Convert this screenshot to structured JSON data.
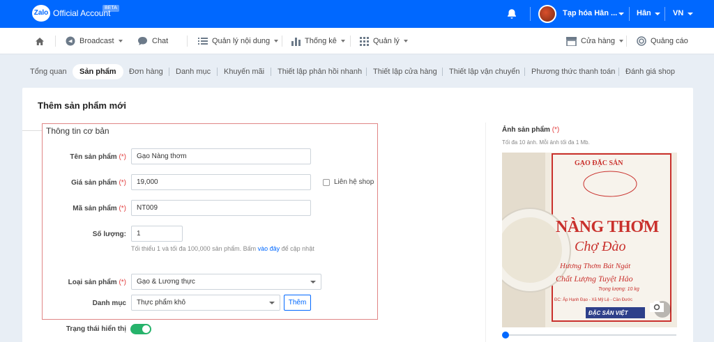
{
  "header": {
    "logo_badge": "Zalo",
    "logo_text": "Official Account",
    "beta": "BETA",
    "shop_name": "Tạp hóa Hân ...",
    "user": "Hân",
    "lang": "VN"
  },
  "nav": {
    "broadcast": "Broadcast",
    "chat": "Chat",
    "content": "Quản lý nội dung",
    "stats": "Thống kê",
    "manage": "Quản lý",
    "store": "Cửa hàng",
    "ads": "Quảng cáo"
  },
  "tabs": [
    "Tổng quan",
    "Sản phẩm",
    "Đơn hàng",
    "Danh mục",
    "Khuyến mãi",
    "Thiết lập phản hồi nhanh",
    "Thiết lập cửa hàng",
    "Thiết lập vận chuyển",
    "Phương thức thanh toán",
    "Đánh giá shop"
  ],
  "form": {
    "title": "Thêm sản phẩm mới",
    "section_title": "Thông tin cơ bản",
    "req_mark": "(*)",
    "name_label": "Tên sản phẩm",
    "name_value": "Gạo Nàng thơm",
    "price_label": "Giá sản phẩm",
    "price_value": "19,000",
    "contact_label": "Liên hệ shop",
    "sku_label": "Mã sản phẩm",
    "sku_value": "NT009",
    "qty_label": "Số lượng:",
    "qty_value": "1",
    "qty_hint_a": "Tối thiểu 1 và tối đa 100,000 sản phẩm. Bấm ",
    "qty_hint_link": "vào đây",
    "qty_hint_b": " để cập nhật",
    "type_label": "Loại sản phẩm",
    "type_value": "Gạo & Lương thực",
    "category_label": "Danh mục",
    "category_value": "Thực phẩm khô",
    "add_button": "Thêm",
    "status_label": "Trạng thái hiển thị",
    "status_on": true
  },
  "images": {
    "label": "Ảnh sản phẩm",
    "hint": "Tối đa 10 ảnh. Mỗi ảnh tối đa 1 Mb.",
    "photo": {
      "line1": "GẠO ĐẶC SẢN",
      "line2": "NÀNG THƠM",
      "line3": "Chợ Đào",
      "line4": "Hương Thơm Bát Ngát",
      "line5": "Chất Lượng Tuyệt Hảo",
      "line6": "Trọng lượng: 10 kg",
      "line7": "ĐC: Ấp Hạnh Đạo - Xã Mỹ Lệ - Cần Đước",
      "line8": "ĐẶC SẢN VIỆT"
    }
  },
  "colors": {
    "brand": "#0068ff",
    "required": "#e23d3d",
    "section_border": "#e08585",
    "toggle_on": "#26b36b"
  }
}
